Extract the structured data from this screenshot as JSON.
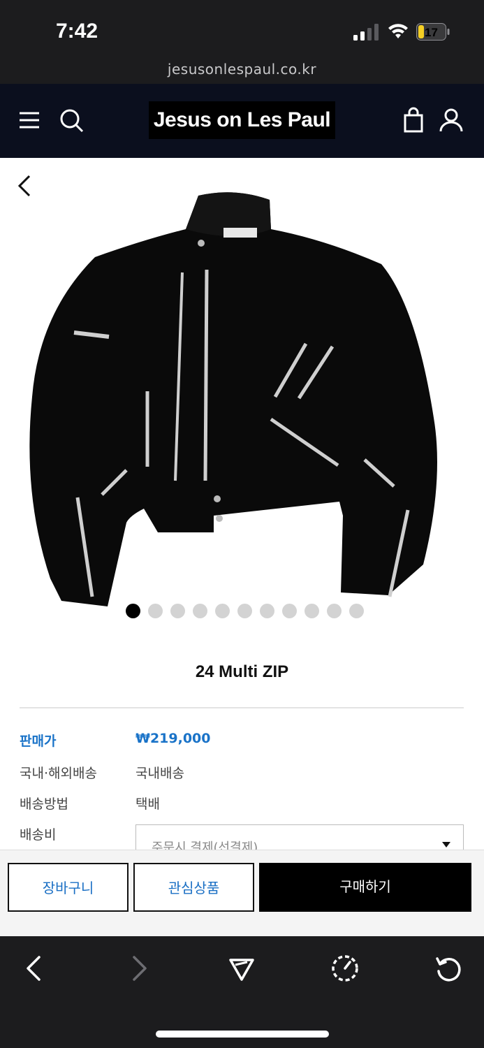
{
  "status_bar": {
    "time": "7:42",
    "battery": "17",
    "icons": [
      "signal-icon",
      "wifi-icon",
      "battery-icon"
    ]
  },
  "browser": {
    "url": "jesusonlespaul.co.kr"
  },
  "header": {
    "logo": "Jesus on Les Paul",
    "icons": [
      "menu-icon",
      "search-icon",
      "bag-icon",
      "user-icon"
    ]
  },
  "product": {
    "name": "24 Multi ZIP",
    "image_count": 11,
    "active_image": 1,
    "info": [
      {
        "label": "판매가",
        "value": "₩219,000"
      },
      {
        "label": "국내·해외배송",
        "value": "국내배송"
      },
      {
        "label": "배송방법",
        "value": "택배"
      },
      {
        "label": "배송비",
        "value": ""
      }
    ],
    "shipping_select": "주문시 결제(선결제)"
  },
  "actions": {
    "cart": "장바구니",
    "wishlist": "관심상품",
    "buy": "구매하기"
  },
  "toolbar": {
    "icons": [
      "back-icon",
      "forward-icon",
      "share-icon",
      "speed-icon",
      "reload-icon"
    ]
  },
  "colors": {
    "accent_blue": "#1a73c8",
    "header_bg": "#0b0f1e",
    "browser_bg": "#1c1c1e",
    "battery_yellow": "#f5cf24"
  }
}
